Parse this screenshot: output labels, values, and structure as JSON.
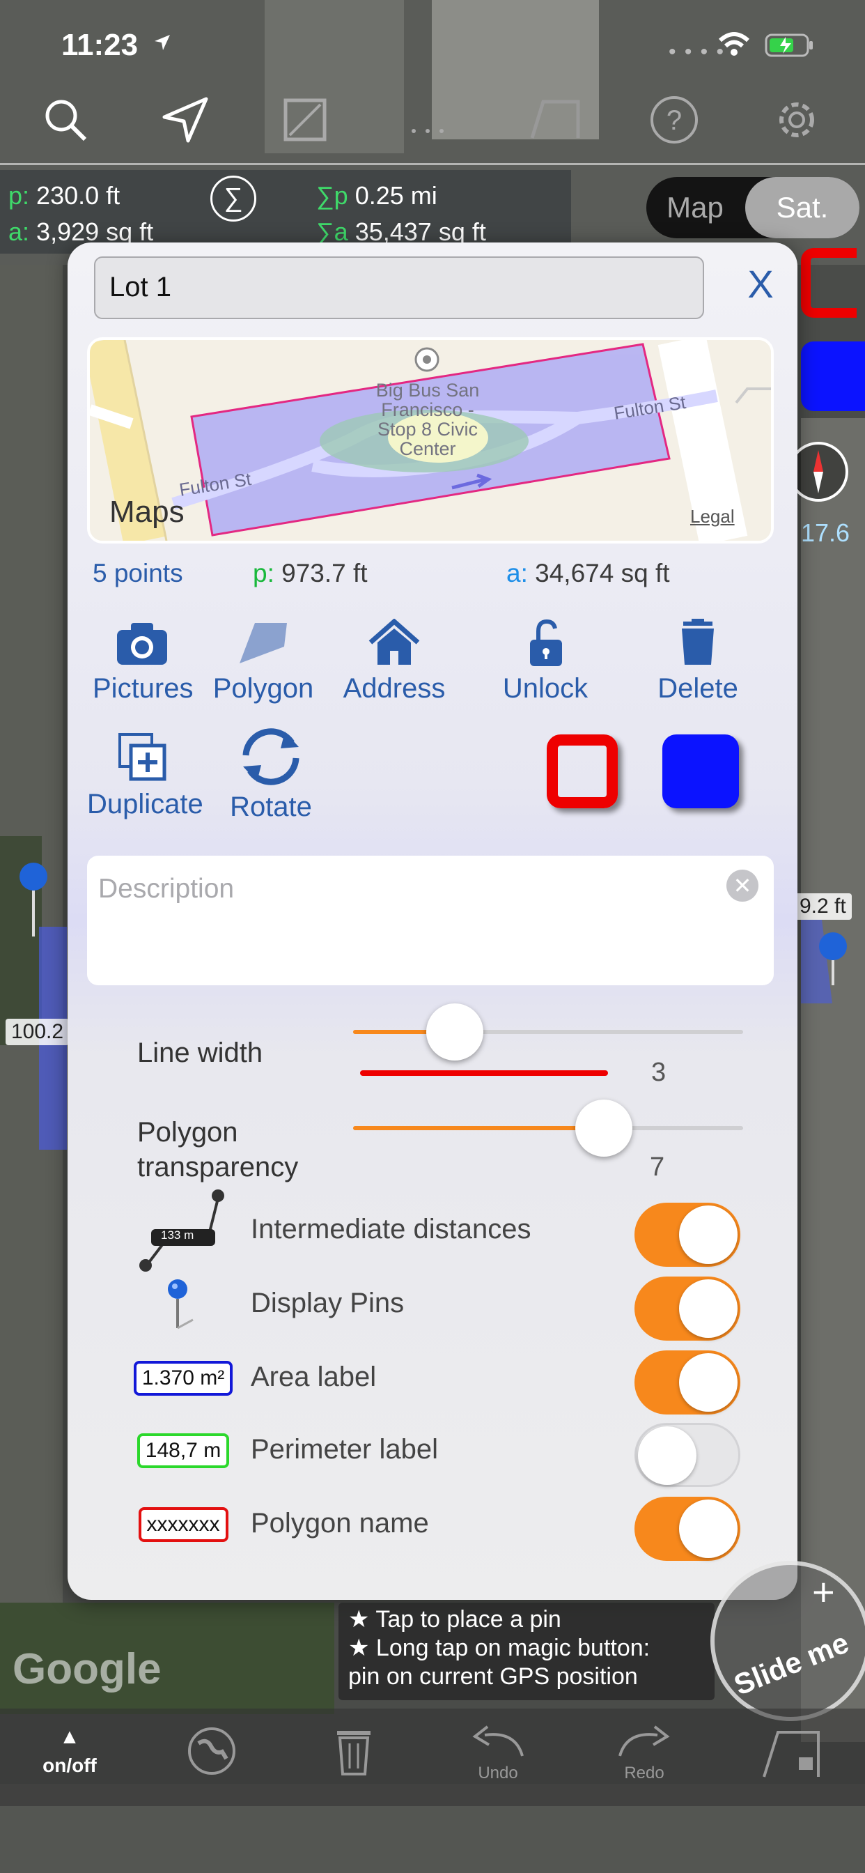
{
  "status": {
    "time": "11:23",
    "dots": "• • • •"
  },
  "stats": {
    "p_key": "p:",
    "p_val": "230.0 ft",
    "a_key": "a:",
    "a_val": "3,929 sq ft",
    "sum_p_key": "∑p",
    "sum_p_val": "0.25 mi",
    "sum_a_key": "∑a",
    "sum_a_val": "35,437 sq ft",
    "sigma": "∑"
  },
  "map_toggle": {
    "map": "Map",
    "sat": "Sat.",
    "selected": "Sat."
  },
  "side": {
    "value": "17.6"
  },
  "panel": {
    "name_value": "Lot 1",
    "close_label": "X",
    "minimap": {
      "poi": "Big Bus San Francisco - Stop 8 Civic Center",
      "poi_lines": [
        "Big Bus San",
        "Francisco -",
        "Stop 8 Civic",
        "Center"
      ],
      "street_left": "Fulton St",
      "street_right": "Fulton St",
      "brand": "Maps",
      "legal": "Legal"
    },
    "info": {
      "points": "5 points",
      "p_key": "p:",
      "p_val": "973.7 ft",
      "a_key": "a:",
      "a_val": "34,674 sq ft"
    },
    "actions": {
      "pictures": "Pictures",
      "polygon": "Polygon",
      "address": "Address",
      "unlock": "Unlock",
      "delete": "Delete",
      "duplicate": "Duplicate",
      "rotate": "Rotate"
    },
    "colors": {
      "line": "#ee0000",
      "fill": "#0b13ff"
    },
    "description_placeholder": "Description",
    "line_width": {
      "label": "Line width",
      "value": "3",
      "fraction": 0.26
    },
    "transparency": {
      "label_1": "Polygon",
      "label_2": "transparency",
      "value": "7",
      "fraction": 0.64
    },
    "options": [
      {
        "label": "Intermediate distances",
        "on": true,
        "icon": "intermediate-distance-icon",
        "badge": "133 m"
      },
      {
        "label": "Display Pins",
        "on": true,
        "icon": "pin-icon"
      },
      {
        "label": "Area label",
        "on": true,
        "icon": "area-label-badge",
        "badge": "1.370 m²"
      },
      {
        "label": "Perimeter label",
        "on": false,
        "icon": "perimeter-label-badge",
        "badge": "148,7 m"
      },
      {
        "label": "Polygon name",
        "on": true,
        "icon": "polygon-name-badge",
        "badge": "xxxxxxx"
      }
    ]
  },
  "map_labels": {
    "dist_left": "100.2",
    "dist_right": "9.2 ft"
  },
  "hint": {
    "line1": "★ Tap to place a pin",
    "line2": "★ Long tap on magic button:",
    "line3": "pin on current GPS position"
  },
  "bottom": {
    "onoff": "on/off",
    "undo": "Undo",
    "redo": "Redo",
    "google": "Google",
    "slide": "Slide me"
  }
}
